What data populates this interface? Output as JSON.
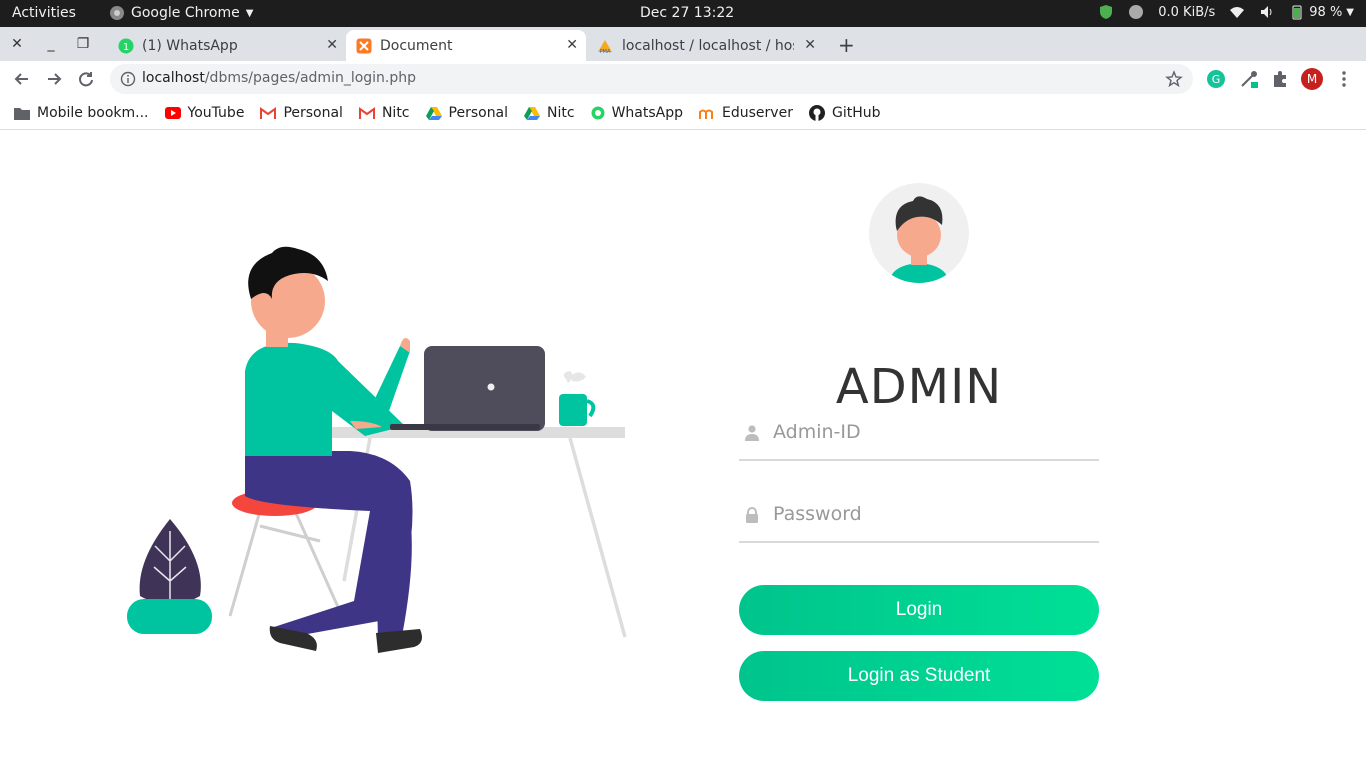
{
  "topbar": {
    "activities": "Activities",
    "app_name": "Google Chrome",
    "clock": "Dec 27  13:22",
    "net_speed": "0.0 KiB/s",
    "battery": "98 %"
  },
  "tabs": [
    {
      "title": "(1) WhatsApp",
      "favicon": "whatsapp-icon",
      "badge": "1"
    },
    {
      "title": "Document",
      "favicon": "xampp-icon"
    },
    {
      "title": "localhost / localhost / hos",
      "favicon": "phpmyadmin-icon"
    }
  ],
  "omnibox": {
    "host": "localhost",
    "path": "/dbms/pages/admin_login.php"
  },
  "profile_initial": "M",
  "bookmarks": [
    {
      "label": "Mobile bookm...",
      "icon": "folder-icon"
    },
    {
      "label": "YouTube",
      "icon": "youtube-icon"
    },
    {
      "label": "Personal",
      "icon": "gmail-icon"
    },
    {
      "label": "Nitc",
      "icon": "gmail-icon"
    },
    {
      "label": "Personal",
      "icon": "drive-icon"
    },
    {
      "label": "Nitc",
      "icon": "drive-icon"
    },
    {
      "label": "WhatsApp",
      "icon": "whatsapp-icon"
    },
    {
      "label": "Eduserver",
      "icon": "moodle-icon"
    },
    {
      "label": "GitHub",
      "icon": "github-icon"
    }
  ],
  "login": {
    "heading": "ADMIN",
    "admin_id_placeholder": "Admin-ID",
    "password_placeholder": "Password",
    "login_label": "Login",
    "student_login_label": "Login as Student"
  },
  "colors": {
    "accent_green": "#00d495",
    "shirt_teal": "#00c4a0",
    "pants_purple": "#3f3587",
    "laptop_gray": "#4f4c5c"
  }
}
